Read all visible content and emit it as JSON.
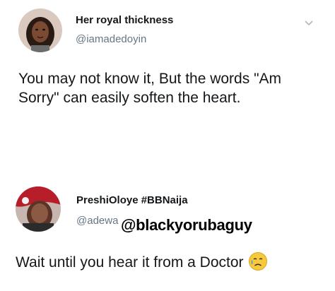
{
  "tweets": [
    {
      "display_name": "Her royal thickness",
      "handle": "@iamadedoyin",
      "text": "You may not know it, But the words \"Am Sorry\" can easily soften the heart.",
      "menu_icon": "chevron-down-icon"
    },
    {
      "display_name": "PreshiOloye #BBNaija",
      "handle": "@adewa",
      "handle_overlay": "@blackyorubaguy",
      "text": "Wait until you hear it from a Doctor",
      "emoji": "sad-sweat-face-emoji"
    }
  ],
  "colors": {
    "text": "#14171a",
    "secondary": "#657786",
    "background": "#ffffff"
  }
}
